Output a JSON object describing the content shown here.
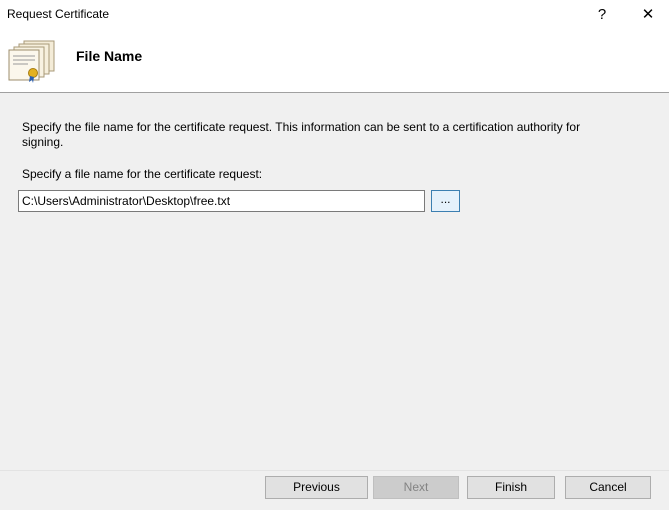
{
  "window": {
    "title": "Request Certificate",
    "help_label": "?",
    "close_label": "✕"
  },
  "header": {
    "title": "File Name"
  },
  "main": {
    "description": "Specify the file name for the certificate request. This information can be sent to a certification authority for signing.",
    "field_label": "Specify a file name for the certificate request:",
    "file_path": "C:\\Users\\Administrator\\Desktop\\free.txt",
    "browse_label": "..."
  },
  "footer": {
    "previous_label": "Previous",
    "next_label": "Next",
    "finish_label": "Finish",
    "cancel_label": "Cancel"
  }
}
